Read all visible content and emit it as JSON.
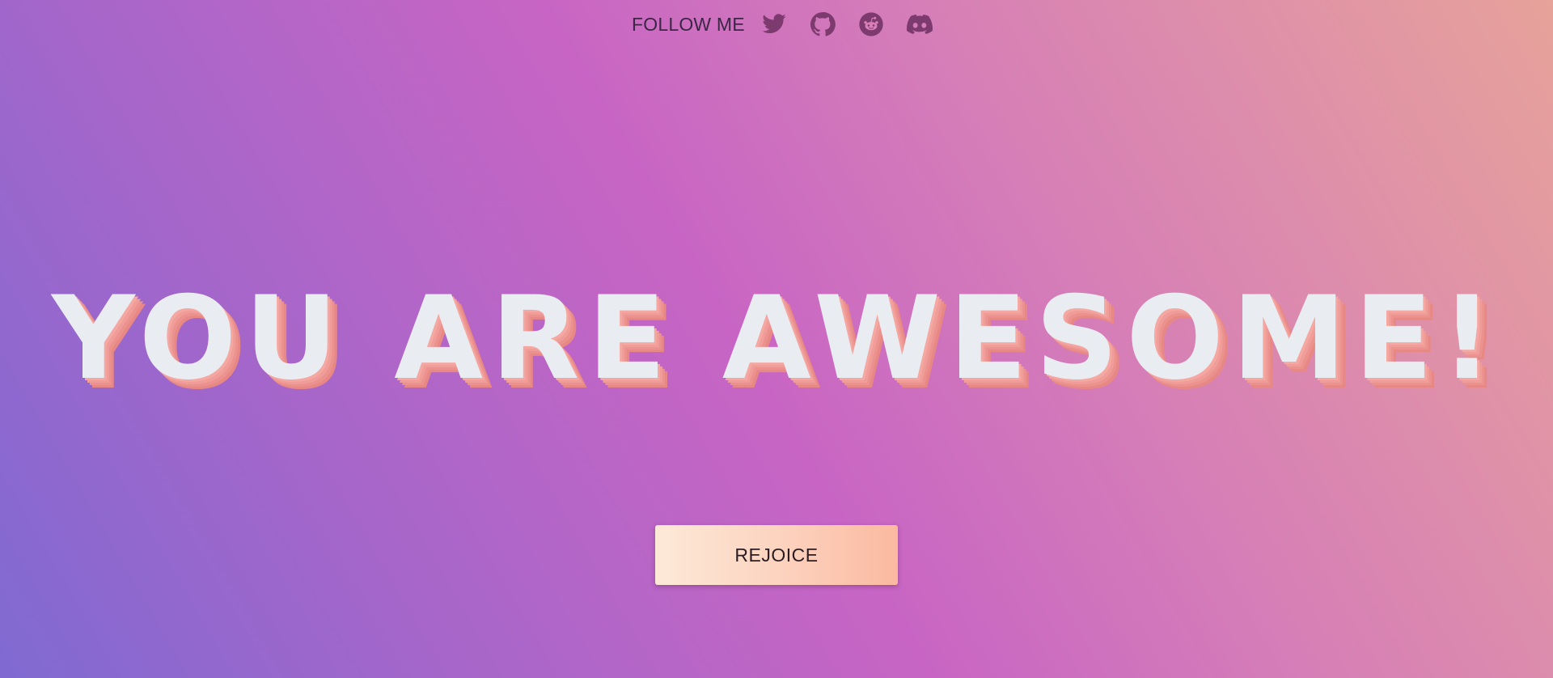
{
  "header": {
    "follow_label": "FOLLOW ME",
    "social": [
      {
        "name": "twitter",
        "icon": "twitter-icon"
      },
      {
        "name": "github",
        "icon": "github-icon"
      },
      {
        "name": "reddit",
        "icon": "reddit-icon"
      },
      {
        "name": "discord",
        "icon": "discord-icon"
      }
    ]
  },
  "main": {
    "headline": "YOU ARE AWESOME!",
    "button_label": "REJOICE"
  },
  "colors": {
    "headline_text": "#e9edf2",
    "headline_shadow": "#ec928e",
    "icon_color": "#7c3a6e",
    "label_color": "#3b2646",
    "gradient_start": "#7f6ad2",
    "gradient_mid": "#c865c4",
    "gradient_end": "#e7a29a",
    "button_gradient_start": "#fde9d8",
    "button_gradient_end": "#fbb9a0"
  }
}
